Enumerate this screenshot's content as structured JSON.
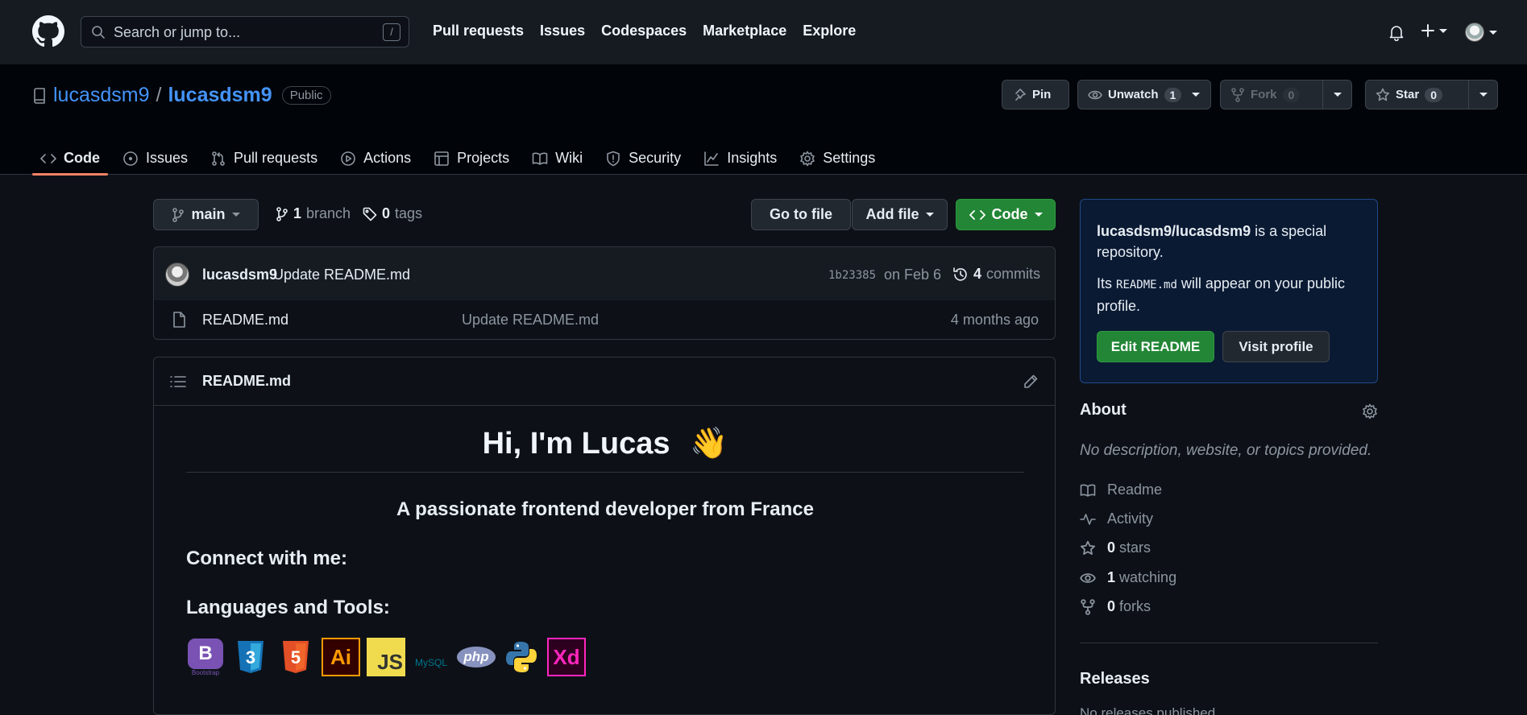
{
  "header": {
    "search_placeholder": "Search or jump to...",
    "search_key": "/",
    "nav": [
      "Pull requests",
      "Issues",
      "Codespaces",
      "Marketplace",
      "Explore"
    ]
  },
  "repo": {
    "owner": "lucasdsm9",
    "separator": "/",
    "name": "lucasdsm9",
    "visibility": "Public",
    "pin_label": "Pin",
    "unwatch_label": "Unwatch",
    "watch_count": "1",
    "fork_label": "Fork",
    "fork_count": "0",
    "star_label": "Star",
    "star_count": "0"
  },
  "tabs": [
    "Code",
    "Issues",
    "Pull requests",
    "Actions",
    "Projects",
    "Wiki",
    "Security",
    "Insights",
    "Settings"
  ],
  "toolbar": {
    "branch": "main",
    "branch_count": "1",
    "branch_label": "branch",
    "tag_count": "0",
    "tag_label": "tags",
    "go_to_file": "Go to file",
    "add_file": "Add file",
    "code": "Code"
  },
  "commit": {
    "author": "lucasdsm9",
    "message": "Update README.md",
    "hash": "1b23385",
    "date": "on Feb 6",
    "count": "4",
    "count_label": "commits"
  },
  "files": [
    {
      "name": "README.md",
      "message": "Update README.md",
      "age": "4 months ago"
    }
  ],
  "readme": {
    "filename": "README.md",
    "title": "Hi, I'm Lucas",
    "wave": "👋",
    "subtitle": "A passionate frontend developer from France",
    "connect": "Connect with me:",
    "languages": "Languages and Tools:",
    "tools": [
      "bootstrap",
      "css3",
      "html5",
      "illustrator",
      "javascript",
      "mysql",
      "php",
      "python",
      "xd"
    ],
    "tool_text": {
      "bootstrap": "B",
      "bootstrap_caption": "Bootstrap",
      "css3": "3",
      "html5": "5",
      "illustrator": "Ai",
      "javascript": "JS",
      "mysql": "MySQL",
      "php": "php",
      "xd": "Xd"
    }
  },
  "special": {
    "repo_ref": "lucasdsm9/lucasdsm9",
    "text1": " is a special repository.",
    "text2_pre": "Its ",
    "text2_code": "README.md",
    "text2_post": " will appear on your public profile.",
    "edit_button": "Edit README",
    "visit_button": "Visit profile"
  },
  "about": {
    "heading": "About",
    "description": "No description, website, or topics provided.",
    "readme": "Readme",
    "activity": "Activity",
    "stars_count": "0",
    "stars_label": "stars",
    "watching_count": "1",
    "watching_label": "watching",
    "forks_count": "0",
    "forks_label": "forks"
  },
  "releases": {
    "heading": "Releases",
    "empty": "No releases published"
  },
  "colors": {
    "background": "#0d1117",
    "accent_link": "#4493f8",
    "primary_button": "#238636",
    "tab_underline": "#f78166"
  }
}
